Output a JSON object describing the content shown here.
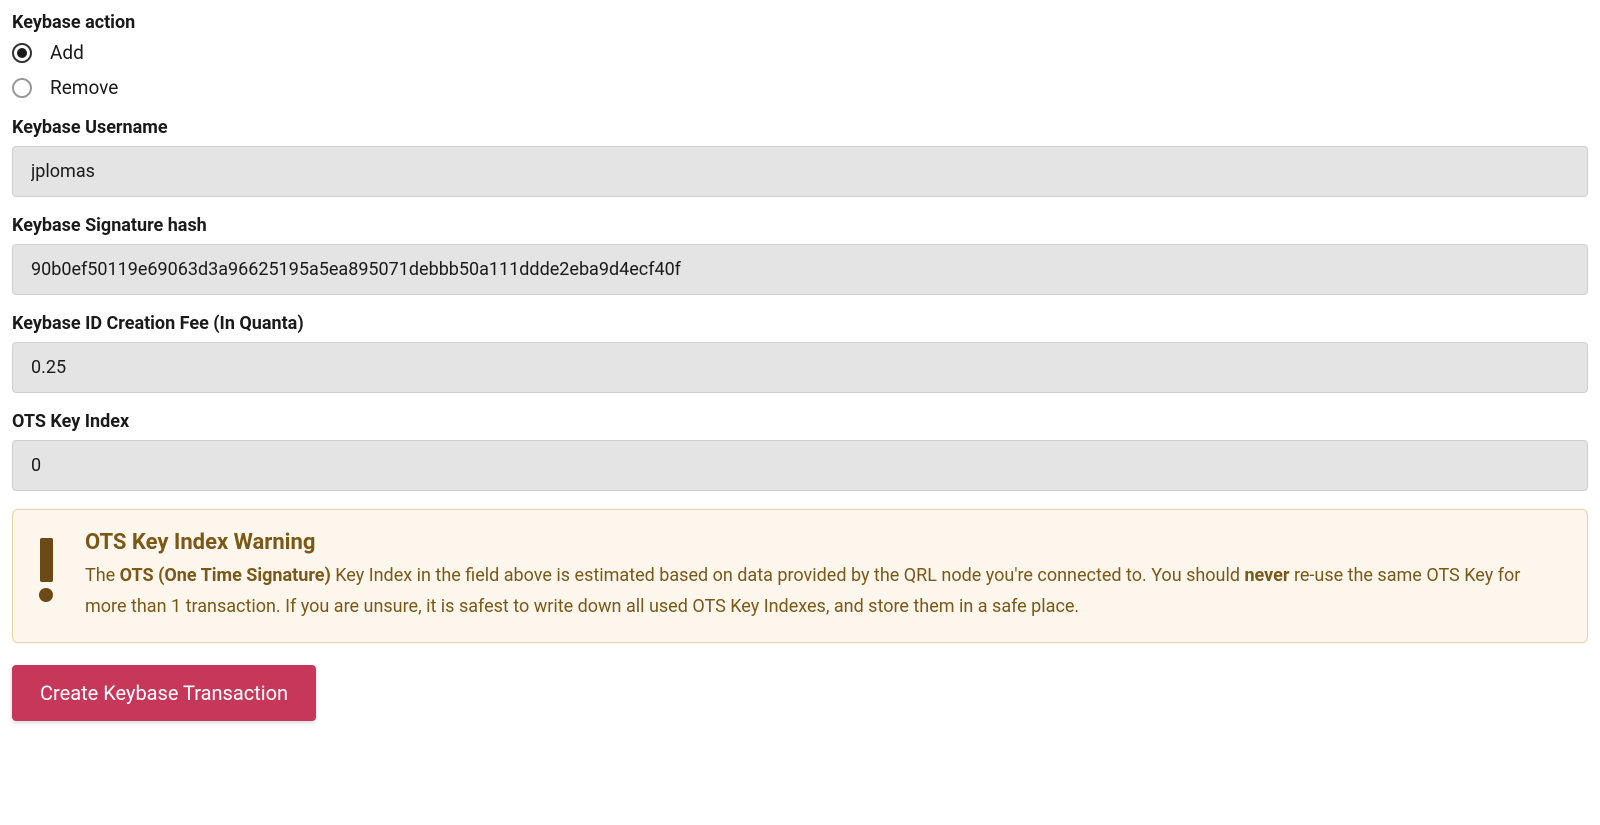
{
  "form": {
    "action_label": "Keybase action",
    "radio_add": "Add",
    "radio_remove": "Remove",
    "radio_selected": "add",
    "username_label": "Keybase Username",
    "username_value": "jplomas",
    "signature_label": "Keybase Signature hash",
    "signature_value": "90b0ef50119e69063d3a96625195a5ea895071debbb50a111ddde2eba9d4ecf40f",
    "fee_label": "Keybase ID Creation Fee (In Quanta)",
    "fee_value": "0.25",
    "ots_label": "OTS Key Index",
    "ots_value": "0",
    "submit_label": "Create Keybase Transaction"
  },
  "warning": {
    "title": "OTS Key Index Warning",
    "text_part1": "The ",
    "text_strong1": "OTS (One Time Signature)",
    "text_part2": " Key Index in the field above is estimated based on data provided by the QRL node you're connected to. You should ",
    "text_strong2": "never",
    "text_part3": " re-use the same OTS Key for more than 1 transaction. If you are unsure, it is safest to write down all used OTS Key Indexes, and store them in a safe place."
  }
}
